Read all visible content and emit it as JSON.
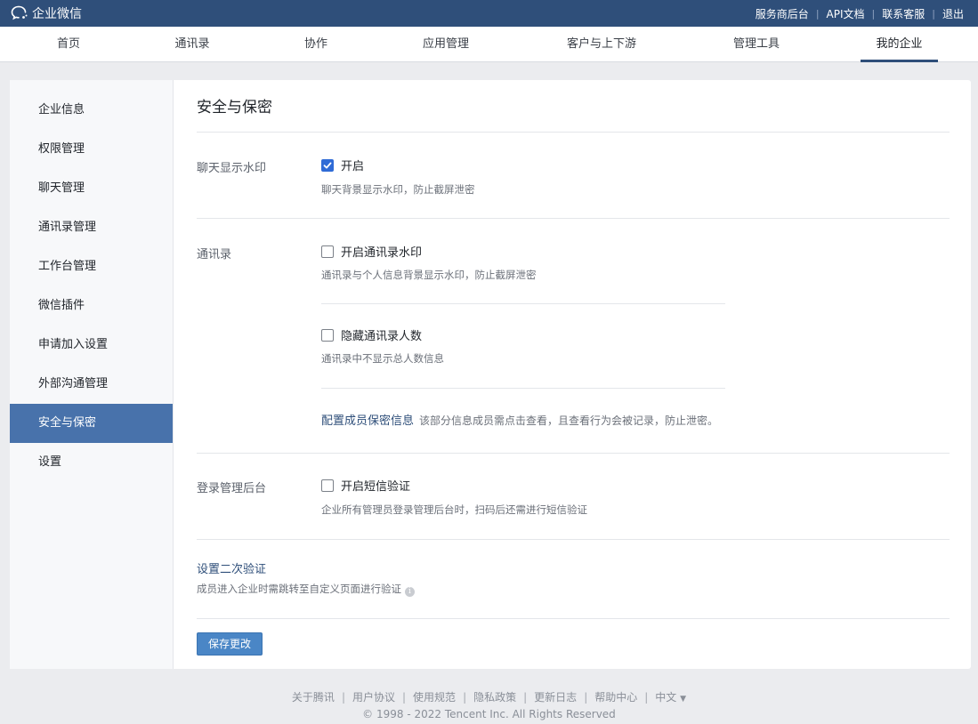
{
  "topbar": {
    "brand": "企业微信",
    "links": [
      "服务商后台",
      "API文档",
      "联系客服",
      "退出"
    ]
  },
  "nav": {
    "items": [
      "首页",
      "通讯录",
      "协作",
      "应用管理",
      "客户与上下游",
      "管理工具",
      "我的企业"
    ],
    "active": "我的企业"
  },
  "sidebar": {
    "items": [
      "企业信息",
      "权限管理",
      "聊天管理",
      "通讯录管理",
      "工作台管理",
      "微信插件",
      "申请加入设置",
      "外部沟通管理",
      "安全与保密",
      "设置"
    ],
    "active": "安全与保密"
  },
  "main": {
    "title": "安全与保密",
    "watermark": {
      "label": "聊天显示水印",
      "option": "开启",
      "checked": true,
      "desc": "聊天背景显示水印，防止截屏泄密"
    },
    "contacts": {
      "label": "通讯录",
      "watermark_option": "开启通讯录水印",
      "watermark_checked": false,
      "watermark_desc": "通讯录与个人信息背景显示水印，防止截屏泄密",
      "hide_count_option": "隐藏通讯录人数",
      "hide_count_checked": false,
      "hide_count_desc": "通讯录中不显示总人数信息",
      "config_link": "配置成员保密信息",
      "config_desc": "该部分信息成员需点击查看，且查看行为会被记录，防止泄密。"
    },
    "login": {
      "label": "登录管理后台",
      "option": "开启短信验证",
      "checked": false,
      "desc": "企业所有管理员登录管理后台时，扫码后还需进行短信验证"
    },
    "second_verify": {
      "title": "设置二次验证",
      "desc": "成员进入企业时需跳转至自定义页面进行验证"
    },
    "save_label": "保存更改"
  },
  "footer": {
    "links": [
      "关于腾讯",
      "用户协议",
      "使用规范",
      "隐私政策",
      "更新日志",
      "帮助中心"
    ],
    "language": "中文",
    "copyright": "© 1998 - 2022 Tencent Inc. All Rights Reserved"
  }
}
